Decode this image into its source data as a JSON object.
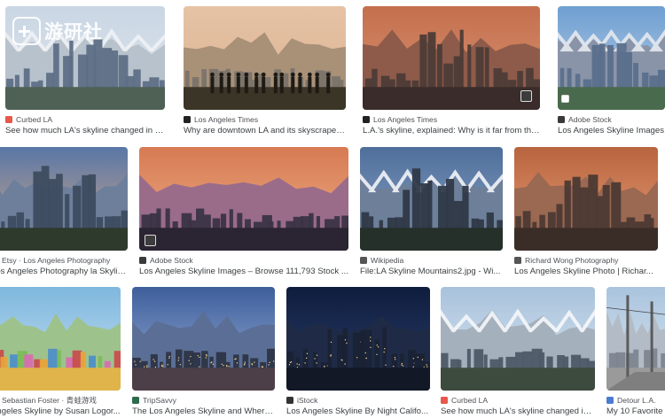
{
  "results": [
    {
      "source": "Curbed LA",
      "title": "See how much LA's skyline changed in 10 ...",
      "favicon_color": "#e8584a",
      "scene": "hazy-mountains"
    },
    {
      "source": "Los Angeles Times",
      "title": "Why are downtown LA and its skyscrapers...",
      "favicon_color": "#222222",
      "scene": "crowd-silhouette"
    },
    {
      "source": "Los Angeles Times",
      "title": "L.A.'s skyline, explained: Why is it far from the ...",
      "favicon_color": "#222222",
      "scene": "sunset-pink"
    },
    {
      "source": "Adobe Stock",
      "title": "Los Angeles Skyline Images",
      "favicon_color": "#3a3a3a",
      "scene": "clear-blue"
    },
    {
      "source": "Etsy · Los Angeles Photography",
      "title": "Los Angeles Photography la Skyline...",
      "favicon_color": "#f1641e",
      "scene": "dusk-clouds"
    },
    {
      "source": "Adobe Stock",
      "title": "Los Angeles Skyline Images – Browse 111,793 Stock ...",
      "favicon_color": "#3a3a3a",
      "scene": "panorama-sunset"
    },
    {
      "source": "Wikipedia",
      "title": "File:LA Skyline Mountains2.jpg - Wi...",
      "favicon_color": "#555555",
      "scene": "snow-mountains"
    },
    {
      "source": "Richard Wong Photography",
      "title": "Los Angeles Skyline Photo | Richar...",
      "favicon_color": "#555555",
      "scene": "sunset-warm"
    },
    {
      "source": "Sebastian Foster · 青蛙游戏",
      "title": "Angeles Skyline by Susan Logor...",
      "favicon_color": "#2e8b57",
      "scene": "painting"
    },
    {
      "source": "TripSavvy",
      "title": "The Los Angeles Skyline and Where...",
      "favicon_color": "#2d6a4f",
      "scene": "dusk-lights"
    },
    {
      "source": "iStock",
      "title": "Los Angeles Skyline By Night Califo...",
      "favicon_color": "#333333",
      "scene": "night"
    },
    {
      "source": "Curbed LA",
      "title": "See how much LA's skyline changed in ...",
      "favicon_color": "#e8584a",
      "scene": "snow-small"
    },
    {
      "source": "Detour L.A.",
      "title": "My 10 Favorite ...",
      "favicon_color": "#4a7bd0",
      "scene": "street"
    }
  ],
  "watermark": {
    "text": "游研社"
  },
  "icons": {
    "favicon": "site-favicon-icon",
    "collection": "collection-badge-icon"
  }
}
